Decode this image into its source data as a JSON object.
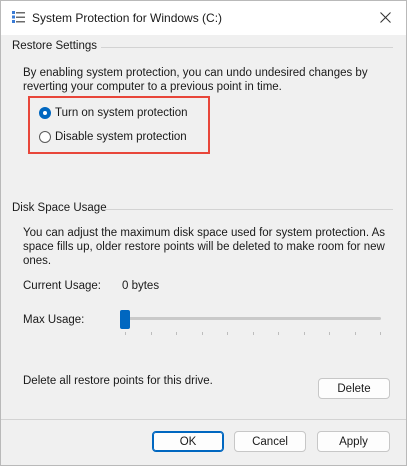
{
  "window": {
    "title": "System Protection for Windows (C:)"
  },
  "restore_settings": {
    "group_title": "Restore Settings",
    "description": "By enabling system protection, you can undo undesired changes by reverting your computer to a previous point in time.",
    "options": [
      {
        "label": "Turn on system protection",
        "selected": true
      },
      {
        "label": "Disable system protection",
        "selected": false
      }
    ],
    "highlight_color": "#e8463a"
  },
  "disk_space": {
    "group_title": "Disk Space Usage",
    "description": "You can adjust the maximum disk space used for system protection. As space fills up, older restore points will be deleted to make room for new ones.",
    "current_usage_label": "Current Usage:",
    "current_usage_value": "0 bytes",
    "max_usage_label": "Max Usage:",
    "max_usage_fraction": 0.0,
    "delete_text": "Delete all restore points for this drive.",
    "delete_button": "Delete"
  },
  "footer": {
    "ok": "OK",
    "cancel": "Cancel",
    "apply": "Apply"
  },
  "accent_color": "#0067c0"
}
